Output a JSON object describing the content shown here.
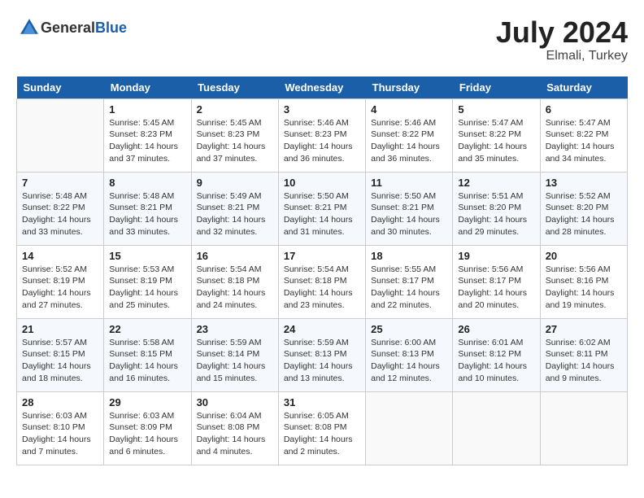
{
  "header": {
    "logo_general": "General",
    "logo_blue": "Blue",
    "title": "July 2024",
    "location": "Elmali, Turkey"
  },
  "calendar": {
    "days_of_week": [
      "Sunday",
      "Monday",
      "Tuesday",
      "Wednesday",
      "Thursday",
      "Friday",
      "Saturday"
    ],
    "weeks": [
      [
        {
          "day": "",
          "info": ""
        },
        {
          "day": "1",
          "info": "Sunrise: 5:45 AM\nSunset: 8:23 PM\nDaylight: 14 hours\nand 37 minutes."
        },
        {
          "day": "2",
          "info": "Sunrise: 5:45 AM\nSunset: 8:23 PM\nDaylight: 14 hours\nand 37 minutes."
        },
        {
          "day": "3",
          "info": "Sunrise: 5:46 AM\nSunset: 8:23 PM\nDaylight: 14 hours\nand 36 minutes."
        },
        {
          "day": "4",
          "info": "Sunrise: 5:46 AM\nSunset: 8:22 PM\nDaylight: 14 hours\nand 36 minutes."
        },
        {
          "day": "5",
          "info": "Sunrise: 5:47 AM\nSunset: 8:22 PM\nDaylight: 14 hours\nand 35 minutes."
        },
        {
          "day": "6",
          "info": "Sunrise: 5:47 AM\nSunset: 8:22 PM\nDaylight: 14 hours\nand 34 minutes."
        }
      ],
      [
        {
          "day": "7",
          "info": "Sunrise: 5:48 AM\nSunset: 8:22 PM\nDaylight: 14 hours\nand 33 minutes."
        },
        {
          "day": "8",
          "info": "Sunrise: 5:48 AM\nSunset: 8:21 PM\nDaylight: 14 hours\nand 33 minutes."
        },
        {
          "day": "9",
          "info": "Sunrise: 5:49 AM\nSunset: 8:21 PM\nDaylight: 14 hours\nand 32 minutes."
        },
        {
          "day": "10",
          "info": "Sunrise: 5:50 AM\nSunset: 8:21 PM\nDaylight: 14 hours\nand 31 minutes."
        },
        {
          "day": "11",
          "info": "Sunrise: 5:50 AM\nSunset: 8:21 PM\nDaylight: 14 hours\nand 30 minutes."
        },
        {
          "day": "12",
          "info": "Sunrise: 5:51 AM\nSunset: 8:20 PM\nDaylight: 14 hours\nand 29 minutes."
        },
        {
          "day": "13",
          "info": "Sunrise: 5:52 AM\nSunset: 8:20 PM\nDaylight: 14 hours\nand 28 minutes."
        }
      ],
      [
        {
          "day": "14",
          "info": "Sunrise: 5:52 AM\nSunset: 8:19 PM\nDaylight: 14 hours\nand 27 minutes."
        },
        {
          "day": "15",
          "info": "Sunrise: 5:53 AM\nSunset: 8:19 PM\nDaylight: 14 hours\nand 25 minutes."
        },
        {
          "day": "16",
          "info": "Sunrise: 5:54 AM\nSunset: 8:18 PM\nDaylight: 14 hours\nand 24 minutes."
        },
        {
          "day": "17",
          "info": "Sunrise: 5:54 AM\nSunset: 8:18 PM\nDaylight: 14 hours\nand 23 minutes."
        },
        {
          "day": "18",
          "info": "Sunrise: 5:55 AM\nSunset: 8:17 PM\nDaylight: 14 hours\nand 22 minutes."
        },
        {
          "day": "19",
          "info": "Sunrise: 5:56 AM\nSunset: 8:17 PM\nDaylight: 14 hours\nand 20 minutes."
        },
        {
          "day": "20",
          "info": "Sunrise: 5:56 AM\nSunset: 8:16 PM\nDaylight: 14 hours\nand 19 minutes."
        }
      ],
      [
        {
          "day": "21",
          "info": "Sunrise: 5:57 AM\nSunset: 8:15 PM\nDaylight: 14 hours\nand 18 minutes."
        },
        {
          "day": "22",
          "info": "Sunrise: 5:58 AM\nSunset: 8:15 PM\nDaylight: 14 hours\nand 16 minutes."
        },
        {
          "day": "23",
          "info": "Sunrise: 5:59 AM\nSunset: 8:14 PM\nDaylight: 14 hours\nand 15 minutes."
        },
        {
          "day": "24",
          "info": "Sunrise: 5:59 AM\nSunset: 8:13 PM\nDaylight: 14 hours\nand 13 minutes."
        },
        {
          "day": "25",
          "info": "Sunrise: 6:00 AM\nSunset: 8:13 PM\nDaylight: 14 hours\nand 12 minutes."
        },
        {
          "day": "26",
          "info": "Sunrise: 6:01 AM\nSunset: 8:12 PM\nDaylight: 14 hours\nand 10 minutes."
        },
        {
          "day": "27",
          "info": "Sunrise: 6:02 AM\nSunset: 8:11 PM\nDaylight: 14 hours\nand 9 minutes."
        }
      ],
      [
        {
          "day": "28",
          "info": "Sunrise: 6:03 AM\nSunset: 8:10 PM\nDaylight: 14 hours\nand 7 minutes."
        },
        {
          "day": "29",
          "info": "Sunrise: 6:03 AM\nSunset: 8:09 PM\nDaylight: 14 hours\nand 6 minutes."
        },
        {
          "day": "30",
          "info": "Sunrise: 6:04 AM\nSunset: 8:08 PM\nDaylight: 14 hours\nand 4 minutes."
        },
        {
          "day": "31",
          "info": "Sunrise: 6:05 AM\nSunset: 8:08 PM\nDaylight: 14 hours\nand 2 minutes."
        },
        {
          "day": "",
          "info": ""
        },
        {
          "day": "",
          "info": ""
        },
        {
          "day": "",
          "info": ""
        }
      ]
    ]
  }
}
